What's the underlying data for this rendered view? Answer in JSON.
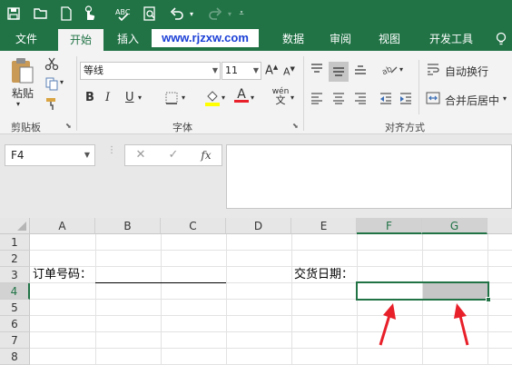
{
  "colors": {
    "excel_green": "#217346",
    "arrow_red": "#e8202a",
    "fill_gray": "#c6c6c6",
    "watermark_blue": "#1b3fd6"
  },
  "quick_access": {
    "icons": [
      "save-icon",
      "open-icon",
      "new-file-icon",
      "touch-mode-icon",
      "spelling-icon",
      "print-preview-icon",
      "undo-icon",
      "redo-icon",
      "customize-icon"
    ]
  },
  "tabs": {
    "file": "文件",
    "home": "开始",
    "insert": "插入",
    "data": "数据",
    "review": "审阅",
    "view": "视图",
    "developer": "开发工具",
    "watermark": "www.rjzxw.com"
  },
  "ribbon": {
    "clipboard": {
      "paste": "粘贴",
      "group_label": "剪贴板"
    },
    "font": {
      "name": "等线",
      "size": "11",
      "bold": "B",
      "italic": "I",
      "underline": "U",
      "font_color": "A",
      "wen": "wén",
      "wen_char": "文",
      "group_label": "字体"
    },
    "alignment": {
      "wrap_text": "自动换行",
      "merge_center": "合并后居中",
      "group_label": "对齐方式"
    }
  },
  "formula_bar": {
    "name_box": "F4",
    "cancel": "✕",
    "enter": "✓",
    "fx": "fx",
    "content": ""
  },
  "sheet": {
    "columns": [
      "A",
      "B",
      "C",
      "D",
      "E",
      "F",
      "G"
    ],
    "rows": [
      "1",
      "2",
      "3",
      "4",
      "5",
      "6",
      "7",
      "8"
    ],
    "selected_cell": "F4",
    "cells": {
      "A3": "订单号码：",
      "E3": "交货日期："
    }
  }
}
